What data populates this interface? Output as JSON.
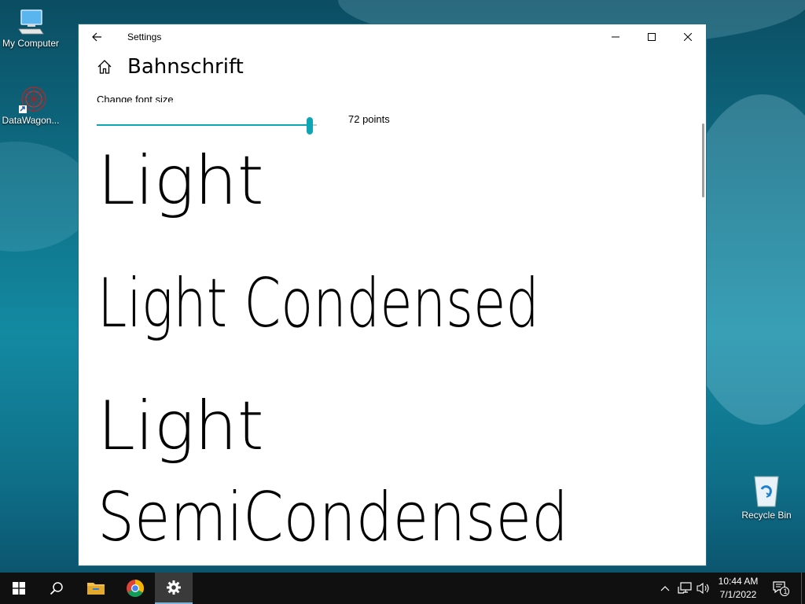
{
  "desktop": {
    "icons": [
      {
        "label": "My Computer"
      },
      {
        "label": "DataWagon..."
      },
      {
        "label": "Recycle Bin"
      }
    ]
  },
  "window": {
    "title": "Settings",
    "page_title": "Bahnschrift",
    "font_size_label": "Change font size",
    "font_size_value": "72 points",
    "slider_fraction": 0.98,
    "samples": [
      "Light",
      "Light Condensed",
      "Light",
      "SemiCondensed"
    ]
  },
  "taskbar": {
    "time": "10:44 AM",
    "date": "7/1/2022",
    "notification_count": "1"
  },
  "colors": {
    "accent": "#0ea5b5",
    "taskbar": "#101010"
  }
}
